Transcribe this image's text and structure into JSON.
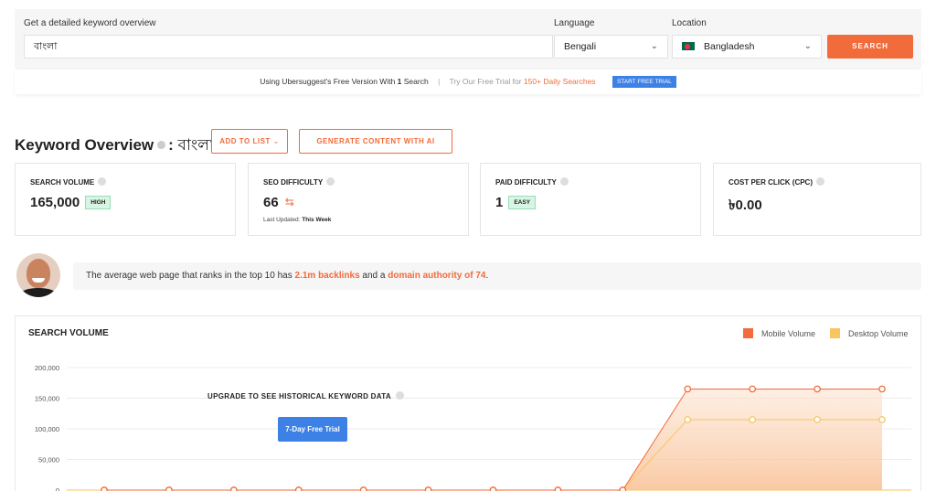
{
  "search": {
    "keyword_label": "Get a detailed keyword overview",
    "keyword_value": "বাংলা",
    "language_label": "Language",
    "language_value": "Bengali",
    "location_label": "Location",
    "location_value": "Bangladesh",
    "search_button": "SEARCH"
  },
  "promo": {
    "text_before": "Using Ubersuggest's Free Version With ",
    "search_count": "1",
    "text_after": " Search",
    "separator": "|",
    "try_text": "Try Our Free Trial for ",
    "highlight": "150+ Daily Searches",
    "trial_button": "START FREE TRIAL"
  },
  "overview": {
    "title": "Keyword Overview",
    "colon": ":",
    "keyword": "বাংলা",
    "add_to_list": "ADD TO LIST",
    "add_to_list_chevron": "⌄",
    "generate": "GENERATE CONTENT WITH AI"
  },
  "cards": [
    {
      "title": "SEARCH VOLUME",
      "value": "165,000",
      "badge": "HIGH"
    },
    {
      "title": "SEO DIFFICULTY",
      "value": "66",
      "sub_label": "Last Updated:",
      "sub_value": "This Week"
    },
    {
      "title": "PAID DIFFICULTY",
      "value": "1",
      "badge": "EASY"
    },
    {
      "title": "COST PER CLICK (CPC)",
      "value": "৳0.00"
    }
  ],
  "tip": {
    "before": "The average web page that ranks in the top 10 has ",
    "backlinks": "2.1m backlinks",
    "middle": " and a ",
    "authority": "domain authority of 74",
    "end": "."
  },
  "chart": {
    "upgrade_text": "UPGRADE TO SEE HISTORICAL KEYWORD DATA",
    "trial_button": "7-Day Free Trial"
  },
  "chart_data": {
    "type": "area",
    "title": "SEARCH VOLUME",
    "ylim": [
      0,
      200000
    ],
    "yticks": [
      "0",
      "50,000",
      "100,000",
      "150,000",
      "200,000"
    ],
    "ytick_values": [
      0,
      50000,
      100000,
      150000,
      200000
    ],
    "grid": true,
    "legend_placement": "top-right",
    "series": [
      {
        "name": "Mobile Volume",
        "color": "#f26b3a",
        "values": [
          0,
          0,
          0,
          0,
          0,
          0,
          0,
          0,
          0,
          165000,
          165000,
          165000,
          165000
        ]
      },
      {
        "name": "Desktop Volume",
        "color": "#f8c55e",
        "values": [
          0,
          0,
          0,
          0,
          0,
          0,
          0,
          0,
          0,
          115000,
          115000,
          115000,
          115000
        ]
      }
    ]
  }
}
